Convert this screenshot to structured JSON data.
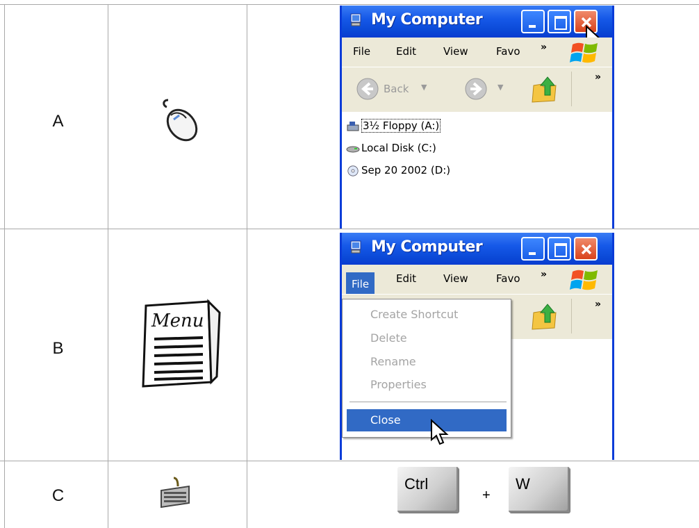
{
  "rows": [
    {
      "label": "A"
    },
    {
      "label": "B"
    },
    {
      "label": "C"
    }
  ],
  "window": {
    "title": "My Computer",
    "menu": {
      "file": "File",
      "edit": "Edit",
      "view": "View",
      "favorites": "Favo",
      "more": "»"
    },
    "toolbar": {
      "back": "Back",
      "more": "»"
    },
    "drives": [
      {
        "name": "3½ Floppy (A:)",
        "icon": "floppy-drive-icon"
      },
      {
        "name": "Local Disk (C:)",
        "icon": "hard-disk-icon"
      },
      {
        "name": "Sep 20 2002 (D:)",
        "icon": "cd-drive-icon"
      }
    ]
  },
  "file_menu": {
    "items": [
      "Create Shortcut",
      "Delete",
      "Rename",
      "Properties"
    ],
    "close": "Close"
  },
  "shortcut": {
    "key1": "Ctrl",
    "plus": "+",
    "key2": "W"
  },
  "colors": {
    "xp_title_blue": "#0a48d6",
    "menu_highlight": "#316ac5",
    "close_button": "#d9431c"
  }
}
